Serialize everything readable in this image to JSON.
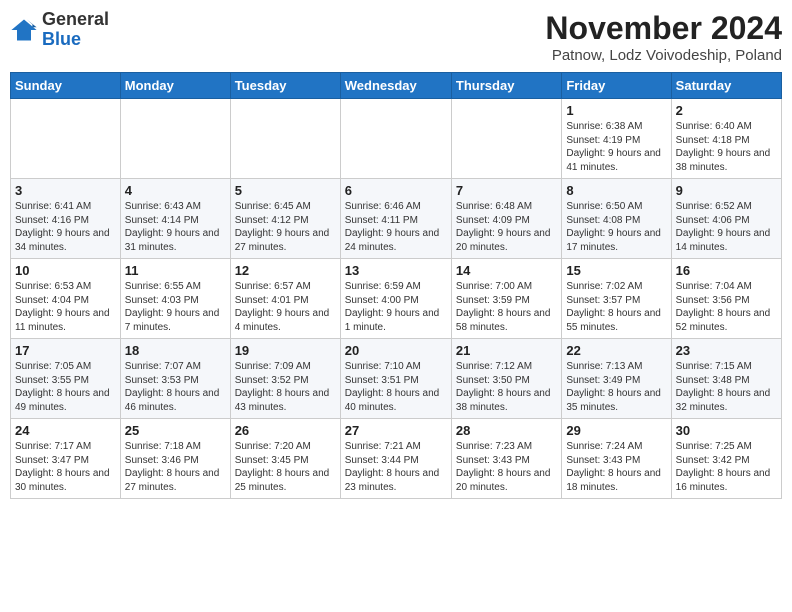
{
  "logo": {
    "general": "General",
    "blue": "Blue"
  },
  "title": "November 2024",
  "location": "Patnow, Lodz Voivodeship, Poland",
  "days_of_week": [
    "Sunday",
    "Monday",
    "Tuesday",
    "Wednesday",
    "Thursday",
    "Friday",
    "Saturday"
  ],
  "weeks": [
    [
      {
        "day": "",
        "info": ""
      },
      {
        "day": "",
        "info": ""
      },
      {
        "day": "",
        "info": ""
      },
      {
        "day": "",
        "info": ""
      },
      {
        "day": "",
        "info": ""
      },
      {
        "day": "1",
        "info": "Sunrise: 6:38 AM\nSunset: 4:19 PM\nDaylight: 9 hours and 41 minutes."
      },
      {
        "day": "2",
        "info": "Sunrise: 6:40 AM\nSunset: 4:18 PM\nDaylight: 9 hours and 38 minutes."
      }
    ],
    [
      {
        "day": "3",
        "info": "Sunrise: 6:41 AM\nSunset: 4:16 PM\nDaylight: 9 hours and 34 minutes."
      },
      {
        "day": "4",
        "info": "Sunrise: 6:43 AM\nSunset: 4:14 PM\nDaylight: 9 hours and 31 minutes."
      },
      {
        "day": "5",
        "info": "Sunrise: 6:45 AM\nSunset: 4:12 PM\nDaylight: 9 hours and 27 minutes."
      },
      {
        "day": "6",
        "info": "Sunrise: 6:46 AM\nSunset: 4:11 PM\nDaylight: 9 hours and 24 minutes."
      },
      {
        "day": "7",
        "info": "Sunrise: 6:48 AM\nSunset: 4:09 PM\nDaylight: 9 hours and 20 minutes."
      },
      {
        "day": "8",
        "info": "Sunrise: 6:50 AM\nSunset: 4:08 PM\nDaylight: 9 hours and 17 minutes."
      },
      {
        "day": "9",
        "info": "Sunrise: 6:52 AM\nSunset: 4:06 PM\nDaylight: 9 hours and 14 minutes."
      }
    ],
    [
      {
        "day": "10",
        "info": "Sunrise: 6:53 AM\nSunset: 4:04 PM\nDaylight: 9 hours and 11 minutes."
      },
      {
        "day": "11",
        "info": "Sunrise: 6:55 AM\nSunset: 4:03 PM\nDaylight: 9 hours and 7 minutes."
      },
      {
        "day": "12",
        "info": "Sunrise: 6:57 AM\nSunset: 4:01 PM\nDaylight: 9 hours and 4 minutes."
      },
      {
        "day": "13",
        "info": "Sunrise: 6:59 AM\nSunset: 4:00 PM\nDaylight: 9 hours and 1 minute."
      },
      {
        "day": "14",
        "info": "Sunrise: 7:00 AM\nSunset: 3:59 PM\nDaylight: 8 hours and 58 minutes."
      },
      {
        "day": "15",
        "info": "Sunrise: 7:02 AM\nSunset: 3:57 PM\nDaylight: 8 hours and 55 minutes."
      },
      {
        "day": "16",
        "info": "Sunrise: 7:04 AM\nSunset: 3:56 PM\nDaylight: 8 hours and 52 minutes."
      }
    ],
    [
      {
        "day": "17",
        "info": "Sunrise: 7:05 AM\nSunset: 3:55 PM\nDaylight: 8 hours and 49 minutes."
      },
      {
        "day": "18",
        "info": "Sunrise: 7:07 AM\nSunset: 3:53 PM\nDaylight: 8 hours and 46 minutes."
      },
      {
        "day": "19",
        "info": "Sunrise: 7:09 AM\nSunset: 3:52 PM\nDaylight: 8 hours and 43 minutes."
      },
      {
        "day": "20",
        "info": "Sunrise: 7:10 AM\nSunset: 3:51 PM\nDaylight: 8 hours and 40 minutes."
      },
      {
        "day": "21",
        "info": "Sunrise: 7:12 AM\nSunset: 3:50 PM\nDaylight: 8 hours and 38 minutes."
      },
      {
        "day": "22",
        "info": "Sunrise: 7:13 AM\nSunset: 3:49 PM\nDaylight: 8 hours and 35 minutes."
      },
      {
        "day": "23",
        "info": "Sunrise: 7:15 AM\nSunset: 3:48 PM\nDaylight: 8 hours and 32 minutes."
      }
    ],
    [
      {
        "day": "24",
        "info": "Sunrise: 7:17 AM\nSunset: 3:47 PM\nDaylight: 8 hours and 30 minutes."
      },
      {
        "day": "25",
        "info": "Sunrise: 7:18 AM\nSunset: 3:46 PM\nDaylight: 8 hours and 27 minutes."
      },
      {
        "day": "26",
        "info": "Sunrise: 7:20 AM\nSunset: 3:45 PM\nDaylight: 8 hours and 25 minutes."
      },
      {
        "day": "27",
        "info": "Sunrise: 7:21 AM\nSunset: 3:44 PM\nDaylight: 8 hours and 23 minutes."
      },
      {
        "day": "28",
        "info": "Sunrise: 7:23 AM\nSunset: 3:43 PM\nDaylight: 8 hours and 20 minutes."
      },
      {
        "day": "29",
        "info": "Sunrise: 7:24 AM\nSunset: 3:43 PM\nDaylight: 8 hours and 18 minutes."
      },
      {
        "day": "30",
        "info": "Sunrise: 7:25 AM\nSunset: 3:42 PM\nDaylight: 8 hours and 16 minutes."
      }
    ]
  ]
}
